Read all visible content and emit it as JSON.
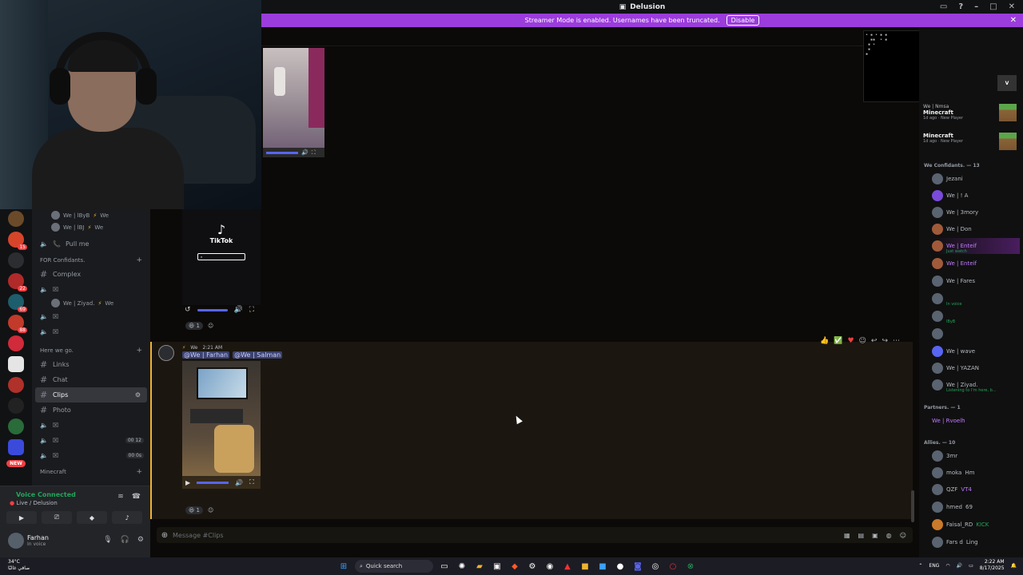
{
  "window": {
    "title": "Delusion",
    "title_icon": "discord-icon"
  },
  "streamer_banner": {
    "text": "Streamer Mode is enabled. Usernames have been truncated.",
    "button": "Disable"
  },
  "server_rail": {
    "badges": [
      "15",
      "22",
      "69",
      "88"
    ],
    "new_label": "NEW"
  },
  "channels": {
    "voice_users_top": [
      "We | lByB",
      "We | lBJ"
    ],
    "user_tag": "We",
    "pull_me": "Pull me",
    "cat_confidants": "FOR Confidants.",
    "complex": "Complex",
    "ziyad": "We | Ziyad.",
    "cat_here": "Here we go.",
    "links": "Links",
    "chat": "Chat",
    "clips": "Clips",
    "photo": "Photo",
    "counter_a": "00 12",
    "counter_b": "00 0s",
    "cat_minecraft": "Minecraft"
  },
  "voice": {
    "title": "Voice Connected",
    "sub": "Live / Delusion"
  },
  "user": {
    "name": "Farhan",
    "status": "In voice"
  },
  "chat": {
    "tiktok_word": "TikTok",
    "reaction_count": "1",
    "msg_time": "2:21 AM",
    "msg_author_tag": "We",
    "mentions": [
      "@We | Farhan",
      "@We | Salman"
    ],
    "composer_placeholder": "Message #Clips"
  },
  "members": {
    "activities": [
      {
        "title": "We | Nmsa",
        "game": "Minecraft",
        "meta": "1d ago · New Player"
      },
      {
        "title": "",
        "game": "Minecraft",
        "meta": "1d ago · New Player"
      }
    ],
    "cat_confidants": "We Confidants. — 13",
    "confidants": [
      {
        "name": "Jezani",
        "sub": ""
      },
      {
        "name": "We | ! A",
        "sub": ""
      },
      {
        "name": "We | 3mory",
        "sub": ""
      },
      {
        "name": "We | Don",
        "sub": ""
      },
      {
        "name": "We | Enteif",
        "sub": "Just watch"
      },
      {
        "name": "We | Enteif",
        "sub": ""
      },
      {
        "name": "We | Fares",
        "sub": ""
      },
      {
        "name": "",
        "sub": "In voice"
      },
      {
        "name": "",
        "sub": "lByB"
      },
      {
        "name": "",
        "sub": ""
      },
      {
        "name": "We | wave",
        "sub": ""
      },
      {
        "name": "We | YAZAN",
        "sub": ""
      },
      {
        "name": "We | Ziyad.",
        "sub": "Listening to I'm here, b..."
      }
    ],
    "cat_partners": "Partners. — 1",
    "partner": "We | Rvoelh",
    "cat_allies": "Allies. — 10",
    "allies": [
      "3mr",
      "moka",
      "QZF",
      "hmed",
      "Faisal_RD",
      "Fars d"
    ],
    "ally_tags": [
      "",
      "Hm",
      "VT4",
      "69",
      "KICK",
      "Ling"
    ]
  },
  "taskbar": {
    "weather": "34°C",
    "weather_sub": "صافي غالبًا",
    "search": "Quick search",
    "lang": "ENG",
    "time": "2:22 AM",
    "date": "8/17/2025"
  }
}
